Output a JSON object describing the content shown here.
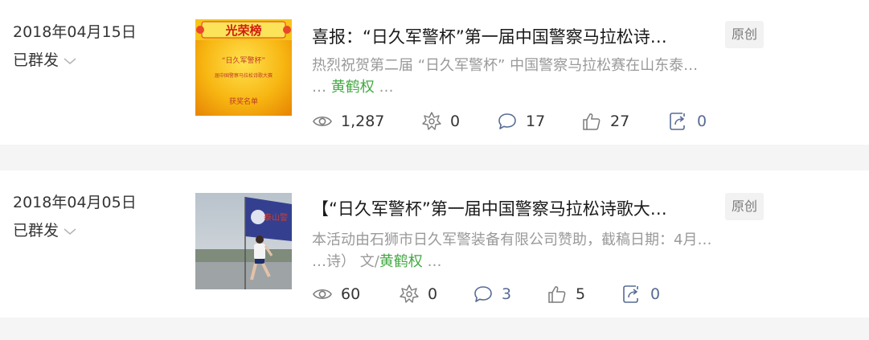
{
  "colors": {
    "author_link": "#43a943",
    "separator": "#f5f5f6",
    "icon_stroke": "#7c7c7c",
    "share_blue": "#576b95"
  },
  "articles": [
    {
      "date": "2018年04月15日",
      "status": "已群发",
      "title": "喜报：“日久军警杯”第一届中国警察马拉松诗…",
      "tag": "原创",
      "desc_line1": "热烈祝贺第二届 “日久军警杯” 中国警察马拉松赛在山东泰…",
      "desc_prefix": "… ",
      "author": "黄鹤权",
      "desc_suffix": " …",
      "thumbnail": {
        "type": "honor-poster",
        "banner_text": "光荣榜",
        "subtitle": "“日久军警杯”",
        "small_text": "届中国警察马拉松诗歌大赛",
        "footer_text": "获奖名单"
      },
      "stats": {
        "views": "1,287",
        "shares_icon": "0",
        "comments": "17",
        "likes": "27",
        "forwards": "0"
      }
    },
    {
      "date": "2018年04月05日",
      "status": "已群发",
      "title": "【“日久军警杯”第一届中国警察马拉松诗歌大…",
      "tag": "原创",
      "desc_line1": "本活动由石狮市日久军警装备有限公司赞助，截稿日期：4月…",
      "desc_prefix": "…诗） 文/",
      "author": "黄鹤权",
      "desc_suffix": " …",
      "thumbnail": {
        "type": "runner-photo",
        "flag_text": "泰山警"
      },
      "stats": {
        "views": "60",
        "shares_icon": "0",
        "comments": "3",
        "likes": "5",
        "forwards": "0"
      }
    }
  ]
}
